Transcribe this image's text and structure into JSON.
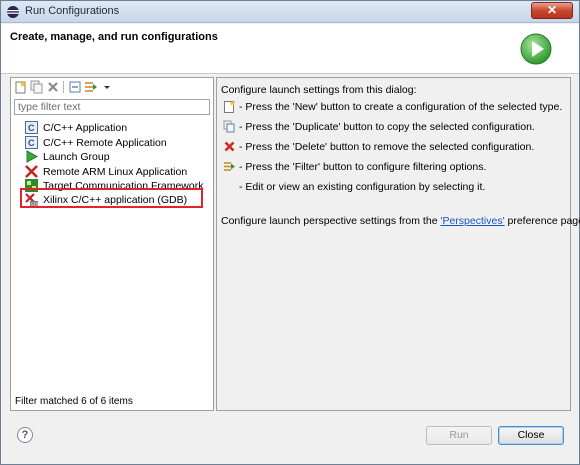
{
  "window": {
    "title": "Run Configurations"
  },
  "header": {
    "heading": "Create, manage, and run configurations"
  },
  "left": {
    "filter_placeholder": "type filter text",
    "toolbar": [
      "new-config-icon",
      "duplicate-icon",
      "delete-icon",
      "collapse-all-icon",
      "filter-icon",
      "dropdown-arrow-icon"
    ],
    "tree": [
      {
        "label": "C/C++ Application",
        "icon": "c-app-icon"
      },
      {
        "label": "C/C++ Remote Application",
        "icon": "c-remote-icon"
      },
      {
        "label": "Launch Group",
        "icon": "launch-group-icon"
      },
      {
        "label": "Remote ARM Linux Application",
        "icon": "xilinx-arm-icon"
      },
      {
        "label": "Target Communication Framework",
        "icon": "tcf-icon"
      },
      {
        "label": "Xilinx C/C++ application (GDB)",
        "icon": "xilinx-gdb-icon"
      }
    ],
    "status": "Filter matched 6 of 6 items"
  },
  "right": {
    "intro": "Configure launch settings from this dialog:",
    "hints": [
      {
        "icon": "new-icon",
        "text": "- Press the 'New' button to create a configuration of the selected type."
      },
      {
        "icon": "duplicate-icon",
        "text": "- Press the 'Duplicate' button to copy the selected configuration."
      },
      {
        "icon": "delete-icon",
        "text": "- Press the 'Delete' button to remove the selected configuration."
      },
      {
        "icon": "filter-icon",
        "text": "- Press the 'Filter' button to configure filtering options."
      },
      {
        "icon": "",
        "text": "- Edit or view an existing configuration by selecting it."
      }
    ],
    "perspectives_prefix": "Configure launch perspective settings from the ",
    "perspectives_link": "'Perspectives'",
    "perspectives_suffix": " preference page."
  },
  "buttons": {
    "run": "Run",
    "close": "Close",
    "help": "?"
  },
  "colors": {
    "highlight": "#e0262a",
    "link": "#1a55c8",
    "run_green": "#3aa83a"
  }
}
